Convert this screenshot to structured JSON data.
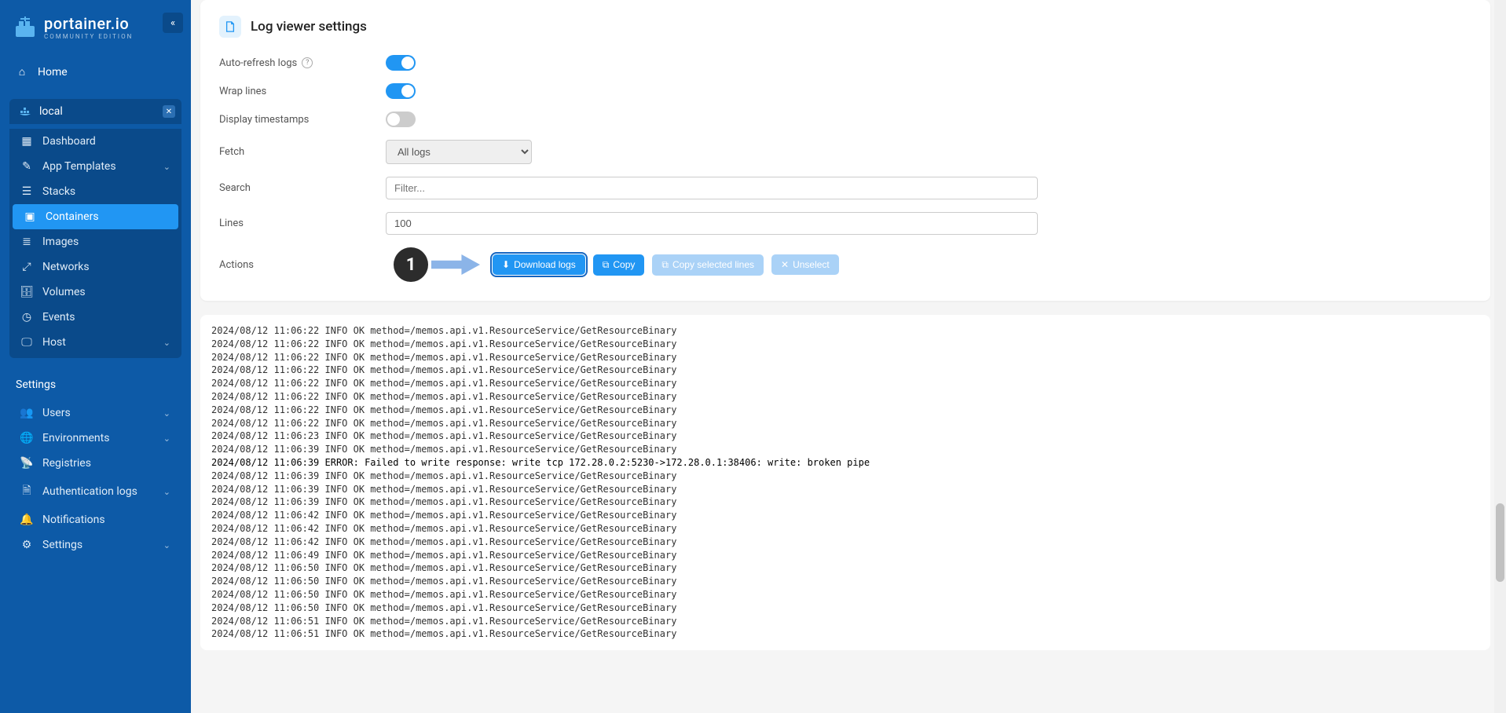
{
  "brand": {
    "title": "portainer.io",
    "subtitle": "COMMUNITY EDITION"
  },
  "nav": {
    "home": "Home",
    "env_label": "local",
    "items": [
      {
        "icon": "dashboard",
        "label": "Dashboard",
        "active": false,
        "chev": false
      },
      {
        "icon": "templates",
        "label": "App Templates",
        "active": false,
        "chev": true
      },
      {
        "icon": "stacks",
        "label": "Stacks",
        "active": false,
        "chev": false
      },
      {
        "icon": "containers",
        "label": "Containers",
        "active": true,
        "chev": false
      },
      {
        "icon": "images",
        "label": "Images",
        "active": false,
        "chev": false
      },
      {
        "icon": "networks",
        "label": "Networks",
        "active": false,
        "chev": false
      },
      {
        "icon": "volumes",
        "label": "Volumes",
        "active": false,
        "chev": false
      },
      {
        "icon": "events",
        "label": "Events",
        "active": false,
        "chev": false
      },
      {
        "icon": "host",
        "label": "Host",
        "active": false,
        "chev": true
      }
    ],
    "settings_title": "Settings",
    "settings_items": [
      {
        "icon": "users",
        "label": "Users",
        "chev": true
      },
      {
        "icon": "envs",
        "label": "Environments",
        "chev": true
      },
      {
        "icon": "registries",
        "label": "Registries",
        "chev": false
      },
      {
        "icon": "authlogs",
        "label": "Authentication logs",
        "chev": true
      },
      {
        "icon": "notifications",
        "label": "Notifications",
        "chev": false
      },
      {
        "icon": "settings",
        "label": "Settings",
        "chev": true
      }
    ]
  },
  "panel": {
    "title": "Log viewer settings",
    "rows": {
      "auto_refresh": "Auto-refresh logs",
      "wrap_lines": "Wrap lines",
      "timestamps": "Display timestamps",
      "fetch": "Fetch",
      "fetch_value": "All logs",
      "search": "Search",
      "search_placeholder": "Filter...",
      "lines": "Lines",
      "lines_value": "100",
      "actions": "Actions"
    },
    "toggles": {
      "auto_refresh": true,
      "wrap_lines": true,
      "timestamps": false
    },
    "buttons": {
      "download": "Download logs",
      "copy": "Copy",
      "copy_selected": "Copy selected lines",
      "unselect": "Unselect"
    }
  },
  "callout": {
    "number": "1"
  },
  "logs": [
    "2024/08/12 11:06:22 INFO OK method=/memos.api.v1.ResourceService/GetResourceBinary",
    "2024/08/12 11:06:22 INFO OK method=/memos.api.v1.ResourceService/GetResourceBinary",
    "2024/08/12 11:06:22 INFO OK method=/memos.api.v1.ResourceService/GetResourceBinary",
    "2024/08/12 11:06:22 INFO OK method=/memos.api.v1.ResourceService/GetResourceBinary",
    "2024/08/12 11:06:22 INFO OK method=/memos.api.v1.ResourceService/GetResourceBinary",
    "2024/08/12 11:06:22 INFO OK method=/memos.api.v1.ResourceService/GetResourceBinary",
    "2024/08/12 11:06:22 INFO OK method=/memos.api.v1.ResourceService/GetResourceBinary",
    "2024/08/12 11:06:22 INFO OK method=/memos.api.v1.ResourceService/GetResourceBinary",
    "2024/08/12 11:06:23 INFO OK method=/memos.api.v1.ResourceService/GetResourceBinary",
    "2024/08/12 11:06:39 INFO OK method=/memos.api.v1.ResourceService/GetResourceBinary",
    "2024/08/12 11:06:39 ERROR: Failed to write response: write tcp 172.28.0.2:5230->172.28.0.1:38406: write: broken pipe",
    "2024/08/12 11:06:39 INFO OK method=/memos.api.v1.ResourceService/GetResourceBinary",
    "2024/08/12 11:06:39 INFO OK method=/memos.api.v1.ResourceService/GetResourceBinary",
    "2024/08/12 11:06:39 INFO OK method=/memos.api.v1.ResourceService/GetResourceBinary",
    "2024/08/12 11:06:42 INFO OK method=/memos.api.v1.ResourceService/GetResourceBinary",
    "2024/08/12 11:06:42 INFO OK method=/memos.api.v1.ResourceService/GetResourceBinary",
    "2024/08/12 11:06:42 INFO OK method=/memos.api.v1.ResourceService/GetResourceBinary",
    "2024/08/12 11:06:49 INFO OK method=/memos.api.v1.ResourceService/GetResourceBinary",
    "2024/08/12 11:06:50 INFO OK method=/memos.api.v1.ResourceService/GetResourceBinary",
    "2024/08/12 11:06:50 INFO OK method=/memos.api.v1.ResourceService/GetResourceBinary",
    "2024/08/12 11:06:50 INFO OK method=/memos.api.v1.ResourceService/GetResourceBinary",
    "2024/08/12 11:06:50 INFO OK method=/memos.api.v1.ResourceService/GetResourceBinary",
    "2024/08/12 11:06:51 INFO OK method=/memos.api.v1.ResourceService/GetResourceBinary",
    "2024/08/12 11:06:51 INFO OK method=/memos.api.v1.ResourceService/GetResourceBinary"
  ]
}
